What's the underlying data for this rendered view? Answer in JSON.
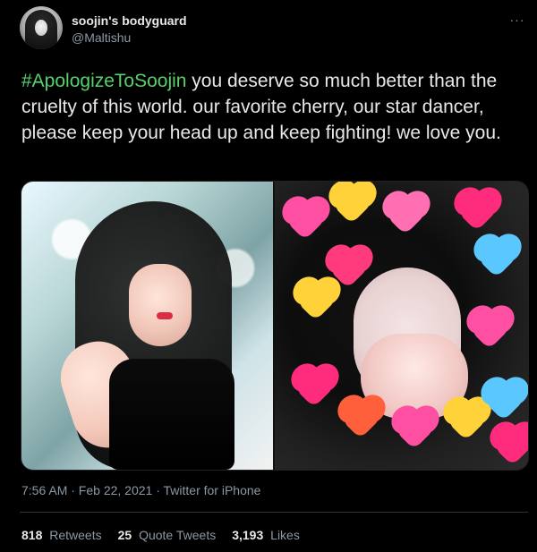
{
  "tweet": {
    "author": {
      "display_name": "soojin's bodyguard",
      "handle": "@Maltishu",
      "avatar_icon": "avatar"
    },
    "more_menu_label": "···",
    "text": {
      "hashtag": "#ApologizeToSoojin",
      "rest": " you deserve so much better than the cruelty of this world. our favorite cherry, our star dancer, please keep your head up and keep fighting! we love you."
    },
    "meta": "7:56 AM · Feb 22, 2021 · Twitter for iPhone",
    "stats": {
      "retweets": {
        "count": "818",
        "label": "Retweets"
      },
      "quote_tweets": {
        "count": "25",
        "label": "Quote Tweets"
      },
      "likes": {
        "count": "3,193",
        "label": "Likes"
      }
    }
  },
  "colors": {
    "background": "#000000",
    "text_primary": "#e7e9ea",
    "text_secondary": "#8b98a5",
    "hashtag": "#57d26b",
    "divider": "#2f3336"
  },
  "icons": [
    "more-icon"
  ]
}
